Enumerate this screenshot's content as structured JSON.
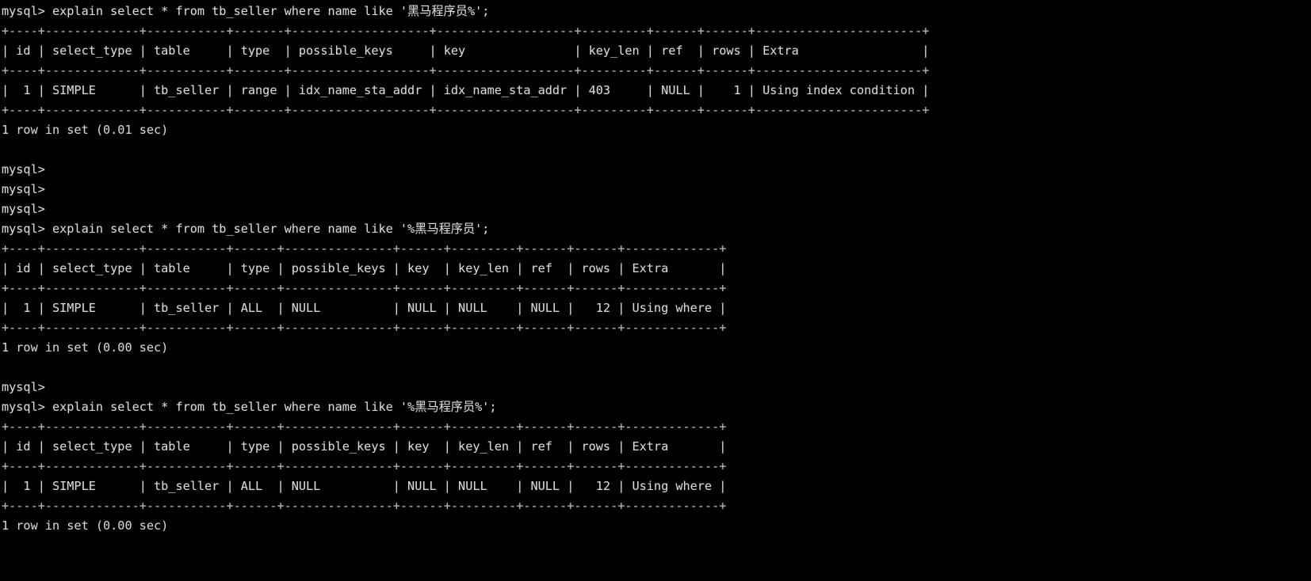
{
  "terminal": {
    "app": "mysql-client-terminal",
    "background_color": "#000000",
    "foreground_color": "#cfcfcf",
    "prompt": "mysql>",
    "lines": [
      "mysql> explain select * from tb_seller where name like '黑马程序员%';",
      "+----+-------------+-----------+-------+-------------------+-------------------+---------+------+------+-----------------------+",
      "| id | select_type | table     | type  | possible_keys     | key               | key_len | ref  | rows | Extra                 |",
      "+----+-------------+-----------+-------+-------------------+-------------------+---------+------+------+-----------------------+",
      "|  1 | SIMPLE      | tb_seller | range | idx_name_sta_addr | idx_name_sta_addr | 403     | NULL |    1 | Using index condition |",
      "+----+-------------+-----------+-------+-------------------+-------------------+---------+------+------+-----------------------+",
      "1 row in set (0.01 sec)",
      "",
      "mysql>",
      "mysql>",
      "mysql>",
      "mysql> explain select * from tb_seller where name like '%黑马程序员';",
      "+----+-------------+-----------+------+---------------+------+---------+------+------+-------------+",
      "| id | select_type | table     | type | possible_keys | key  | key_len | ref  | rows | Extra       |",
      "+----+-------------+-----------+------+---------------+------+---------+------+------+-------------+",
      "|  1 | SIMPLE      | tb_seller | ALL  | NULL          | NULL | NULL    | NULL |   12 | Using where |",
      "+----+-------------+-----------+------+---------------+------+---------+------+------+-------------+",
      "1 row in set (0.00 sec)",
      "",
      "mysql>",
      "mysql> explain select * from tb_seller where name like '%黑马程序员%';",
      "+----+-------------+-----------+------+---------------+------+---------+------+------+-------------+",
      "| id | select_type | table     | type | possible_keys | key  | key_len | ref  | rows | Extra       |",
      "+----+-------------+-----------+------+---------------+------+---------+------+------+-------------+",
      "|  1 | SIMPLE      | tb_seller | ALL  | NULL          | NULL | NULL    | NULL |   12 | Using where |",
      "+----+-------------+-----------+------+---------------+------+---------+------+------+-------------+",
      "1 row in set (0.00 sec)"
    ],
    "blocks": [
      {
        "name": "query-block-1",
        "command": "explain select * from tb_seller where name like '黑马程序员%';",
        "like_pattern": "黑马程序员%",
        "status": "1 row in set (0.01 sec)",
        "columns": [
          "id",
          "select_type",
          "table",
          "type",
          "possible_keys",
          "key",
          "key_len",
          "ref",
          "rows",
          "Extra"
        ],
        "rows": [
          [
            "1",
            "SIMPLE",
            "tb_seller",
            "range",
            "idx_name_sta_addr",
            "idx_name_sta_addr",
            "403",
            "NULL",
            "1",
            "Using index condition"
          ]
        ]
      },
      {
        "name": "query-block-2",
        "command": "explain select * from tb_seller where name like '%黑马程序员';",
        "like_pattern": "%黑马程序员",
        "status": "1 row in set (0.00 sec)",
        "columns": [
          "id",
          "select_type",
          "table",
          "type",
          "possible_keys",
          "key",
          "key_len",
          "ref",
          "rows",
          "Extra"
        ],
        "rows": [
          [
            "1",
            "SIMPLE",
            "tb_seller",
            "ALL",
            "NULL",
            "NULL",
            "NULL",
            "NULL",
            "12",
            "Using where"
          ]
        ]
      },
      {
        "name": "query-block-3",
        "command": "explain select * from tb_seller where name like '%黑马程序员%';",
        "like_pattern": "%黑马程序员%",
        "status": "1 row in set (0.00 sec)",
        "columns": [
          "id",
          "select_type",
          "table",
          "type",
          "possible_keys",
          "key",
          "key_len",
          "ref",
          "rows",
          "Extra"
        ],
        "rows": [
          [
            "1",
            "SIMPLE",
            "tb_seller",
            "ALL",
            "NULL",
            "NULL",
            "NULL",
            "NULL",
            "12",
            "Using where"
          ]
        ]
      }
    ]
  }
}
